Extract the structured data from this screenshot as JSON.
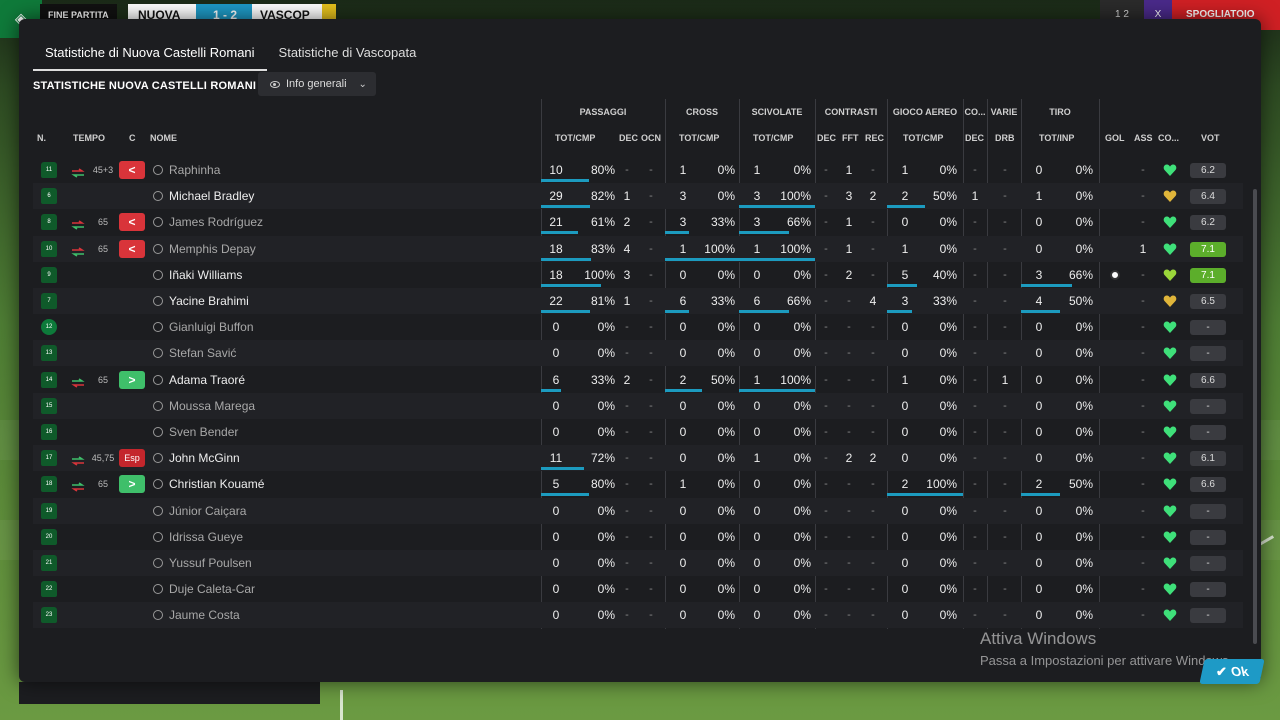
{
  "scoreboard": {
    "status": "FINE PARTITA",
    "home": "NUOVA",
    "score": "1 - 2",
    "away": "VASCOP",
    "right_a": "1 2",
    "right_b": "X",
    "right_c": "SPOGLIATOIO"
  },
  "tabs": [
    {
      "label": "Statistiche di Nuova Castelli Romani",
      "active": true
    },
    {
      "label": "Statistiche di Vascopata",
      "active": false
    }
  ],
  "section_title": "STATISTICHE NUOVA CASTELLI ROMANI",
  "view_dropdown": {
    "label": "Info generali"
  },
  "group_headers": {
    "passaggi": "PASSAGGI",
    "cross": "CROSS",
    "scivolate": "SCIVOLATE",
    "contrasti": "CONTRASTI",
    "gioco_aereo": "GIOCO AEREO",
    "co": "CO...",
    "varie": "VARIE",
    "tiro": "TIRO"
  },
  "column_headers": {
    "n": "N.",
    "tempo": "TEMPO",
    "c": "C",
    "nome": "NOME",
    "pass_tot": "TOT/CMP",
    "pass_dec": "DEC",
    "pass_ocn": "OCN",
    "cross_tot": "TOT/CMP",
    "sciv_tot": "TOT/CMP",
    "con_dec": "DEC",
    "con_fft": "FFT",
    "con_rec": "REC",
    "aereo_tot": "TOT/CMP",
    "co_dec": "DEC",
    "drb": "DRB",
    "tiro_tot": "TOT/INP",
    "gol": "GOL",
    "ass": "ASS",
    "co": "CO...",
    "vot": "VOT"
  },
  "rows": [
    {
      "n": "11",
      "tempo": "45+3",
      "sub": "out",
      "c": "<",
      "name": "Raphinha",
      "dim": true,
      "pass_t": "10",
      "pass_p": "80%",
      "pass_f": 0.8,
      "dec": "-",
      "ocn": "-",
      "cross_t": "1",
      "cross_p": "0%",
      "cross_f": 0,
      "sciv_t": "1",
      "sciv_p": "0%",
      "sciv_f": 0,
      "cdec": "-",
      "fft": "1",
      "rec": "-",
      "aer_t": "1",
      "aer_p": "0%",
      "aer_f": 0,
      "codec": "-",
      "drb": "-",
      "tiro_t": "0",
      "tiro_p": "0%",
      "tiro_f": 0,
      "gol": "",
      "ass": "-",
      "heart": "green",
      "vot": "6.2",
      "vot_good": false
    },
    {
      "n": "6",
      "tempo": "",
      "sub": "",
      "c": "",
      "name": "Michael Bradley",
      "dim": false,
      "pass_t": "29",
      "pass_p": "82%",
      "pass_f": 0.82,
      "dec": "1",
      "ocn": "-",
      "cross_t": "3",
      "cross_p": "0%",
      "cross_f": 0,
      "sciv_t": "3",
      "sciv_p": "100%",
      "sciv_f": 1,
      "cdec": "-",
      "fft": "3",
      "rec": "2",
      "aer_t": "2",
      "aer_p": "50%",
      "aer_f": 0.5,
      "codec": "1",
      "drb": "-",
      "tiro_t": "1",
      "tiro_p": "0%",
      "tiro_f": 0,
      "gol": "",
      "ass": "-",
      "heart": "gold",
      "vot": "6.4",
      "vot_good": false
    },
    {
      "n": "8",
      "tempo": "65",
      "sub": "out",
      "c": "<",
      "name": "James Rodríguez",
      "dim": true,
      "pass_t": "21",
      "pass_p": "61%",
      "pass_f": 0.61,
      "dec": "2",
      "ocn": "-",
      "cross_t": "3",
      "cross_p": "33%",
      "cross_f": 0.33,
      "sciv_t": "3",
      "sciv_p": "66%",
      "sciv_f": 0.66,
      "cdec": "-",
      "fft": "1",
      "rec": "-",
      "aer_t": "0",
      "aer_p": "0%",
      "aer_f": 0,
      "codec": "-",
      "drb": "-",
      "tiro_t": "0",
      "tiro_p": "0%",
      "tiro_f": 0,
      "gol": "",
      "ass": "-",
      "heart": "green",
      "vot": "6.2",
      "vot_good": false
    },
    {
      "n": "10",
      "tempo": "65",
      "sub": "out",
      "c": "<",
      "name": "Memphis Depay",
      "dim": true,
      "pass_t": "18",
      "pass_p": "83%",
      "pass_f": 0.83,
      "dec": "4",
      "ocn": "-",
      "cross_t": "1",
      "cross_p": "100%",
      "cross_f": 1,
      "sciv_t": "1",
      "sciv_p": "100%",
      "sciv_f": 1,
      "cdec": "-",
      "fft": "1",
      "rec": "-",
      "aer_t": "1",
      "aer_p": "0%",
      "aer_f": 0,
      "codec": "-",
      "drb": "-",
      "tiro_t": "0",
      "tiro_p": "0%",
      "tiro_f": 0,
      "gol": "",
      "ass": "1",
      "heart": "green",
      "vot": "7.1",
      "vot_good": true
    },
    {
      "n": "9",
      "tempo": "",
      "sub": "",
      "c": "",
      "name": "Iñaki Williams",
      "dim": false,
      "pass_t": "18",
      "pass_p": "100%",
      "pass_f": 1,
      "dec": "3",
      "ocn": "-",
      "cross_t": "0",
      "cross_p": "0%",
      "cross_f": 0,
      "sciv_t": "0",
      "sciv_p": "0%",
      "sciv_f": 0,
      "cdec": "-",
      "fft": "2",
      "rec": "-",
      "aer_t": "5",
      "aer_p": "40%",
      "aer_f": 0.4,
      "codec": "-",
      "drb": "-",
      "tiro_t": "3",
      "tiro_p": "66%",
      "tiro_f": 0.66,
      "gol": "ball",
      "ass": "-",
      "heart": "yellowgreen",
      "vot": "7.1",
      "vot_good": true
    },
    {
      "n": "7",
      "tempo": "",
      "sub": "",
      "c": "",
      "name": "Yacine Brahimi",
      "dim": false,
      "pass_t": "22",
      "pass_p": "81%",
      "pass_f": 0.81,
      "dec": "1",
      "ocn": "-",
      "cross_t": "6",
      "cross_p": "33%",
      "cross_f": 0.33,
      "sciv_t": "6",
      "sciv_p": "66%",
      "sciv_f": 0.66,
      "cdec": "-",
      "fft": "-",
      "rec": "4",
      "aer_t": "3",
      "aer_p": "33%",
      "aer_f": 0.33,
      "codec": "-",
      "drb": "-",
      "tiro_t": "4",
      "tiro_p": "50%",
      "tiro_f": 0.5,
      "gol": "",
      "ass": "-",
      "heart": "gold",
      "vot": "6.5",
      "vot_good": false
    },
    {
      "n": "12",
      "tempo": "",
      "sub": "",
      "c": "",
      "name": "Gianluigi Buffon",
      "dim": true,
      "gk": true,
      "pass_t": "0",
      "pass_p": "0%",
      "pass_f": 0,
      "dec": "-",
      "ocn": "-",
      "cross_t": "0",
      "cross_p": "0%",
      "cross_f": 0,
      "sciv_t": "0",
      "sciv_p": "0%",
      "sciv_f": 0,
      "cdec": "-",
      "fft": "-",
      "rec": "-",
      "aer_t": "0",
      "aer_p": "0%",
      "aer_f": 0,
      "codec": "-",
      "drb": "-",
      "tiro_t": "0",
      "tiro_p": "0%",
      "tiro_f": 0,
      "gol": "",
      "ass": "-",
      "heart": "green",
      "vot": "-",
      "vot_good": false
    },
    {
      "n": "13",
      "tempo": "",
      "sub": "",
      "c": "",
      "name": "Stefan Savić",
      "dim": true,
      "pass_t": "0",
      "pass_p": "0%",
      "pass_f": 0,
      "dec": "-",
      "ocn": "-",
      "cross_t": "0",
      "cross_p": "0%",
      "cross_f": 0,
      "sciv_t": "0",
      "sciv_p": "0%",
      "sciv_f": 0,
      "cdec": "-",
      "fft": "-",
      "rec": "-",
      "aer_t": "0",
      "aer_p": "0%",
      "aer_f": 0,
      "codec": "-",
      "drb": "-",
      "tiro_t": "0",
      "tiro_p": "0%",
      "tiro_f": 0,
      "gol": "",
      "ass": "-",
      "heart": "green",
      "vot": "-",
      "vot_good": false
    },
    {
      "n": "14",
      "tempo": "65",
      "sub": "in",
      "c": ">",
      "name": "Adama Traoré",
      "dim": false,
      "pass_t": "6",
      "pass_p": "33%",
      "pass_f": 0.33,
      "dec": "2",
      "ocn": "-",
      "cross_t": "2",
      "cross_p": "50%",
      "cross_f": 0.5,
      "sciv_t": "1",
      "sciv_p": "100%",
      "sciv_f": 1,
      "cdec": "-",
      "fft": "-",
      "rec": "-",
      "aer_t": "1",
      "aer_p": "0%",
      "aer_f": 0,
      "codec": "-",
      "drb": "1",
      "tiro_t": "0",
      "tiro_p": "0%",
      "tiro_f": 0,
      "gol": "",
      "ass": "-",
      "heart": "green",
      "vot": "6.6",
      "vot_good": false
    },
    {
      "n": "15",
      "tempo": "",
      "sub": "",
      "c": "",
      "name": "Moussa Marega",
      "dim": true,
      "pass_t": "0",
      "pass_p": "0%",
      "pass_f": 0,
      "dec": "-",
      "ocn": "-",
      "cross_t": "0",
      "cross_p": "0%",
      "cross_f": 0,
      "sciv_t": "0",
      "sciv_p": "0%",
      "sciv_f": 0,
      "cdec": "-",
      "fft": "-",
      "rec": "-",
      "aer_t": "0",
      "aer_p": "0%",
      "aer_f": 0,
      "codec": "-",
      "drb": "-",
      "tiro_t": "0",
      "tiro_p": "0%",
      "tiro_f": 0,
      "gol": "",
      "ass": "-",
      "heart": "green",
      "vot": "-",
      "vot_good": false
    },
    {
      "n": "16",
      "tempo": "",
      "sub": "",
      "c": "",
      "name": "Sven Bender",
      "dim": true,
      "pass_t": "0",
      "pass_p": "0%",
      "pass_f": 0,
      "dec": "-",
      "ocn": "-",
      "cross_t": "0",
      "cross_p": "0%",
      "cross_f": 0,
      "sciv_t": "0",
      "sciv_p": "0%",
      "sciv_f": 0,
      "cdec": "-",
      "fft": "-",
      "rec": "-",
      "aer_t": "0",
      "aer_p": "0%",
      "aer_f": 0,
      "codec": "-",
      "drb": "-",
      "tiro_t": "0",
      "tiro_p": "0%",
      "tiro_f": 0,
      "gol": "",
      "ass": "-",
      "heart": "green",
      "vot": "-",
      "vot_good": false
    },
    {
      "n": "17",
      "tempo": "45,75",
      "sub": "inred",
      "c": "Esp",
      "name": "John McGinn",
      "dim": false,
      "pass_t": "11",
      "pass_p": "72%",
      "pass_f": 0.72,
      "dec": "-",
      "ocn": "-",
      "cross_t": "0",
      "cross_p": "0%",
      "cross_f": 0,
      "sciv_t": "1",
      "sciv_p": "0%",
      "sciv_f": 0,
      "cdec": "-",
      "fft": "2",
      "rec": "2",
      "aer_t": "0",
      "aer_p": "0%",
      "aer_f": 0,
      "codec": "-",
      "drb": "-",
      "tiro_t": "0",
      "tiro_p": "0%",
      "tiro_f": 0,
      "gol": "",
      "ass": "-",
      "heart": "green",
      "vot": "6.1",
      "vot_good": false
    },
    {
      "n": "18",
      "tempo": "65",
      "sub": "in",
      "c": ">",
      "name": "Christian Kouamé",
      "dim": false,
      "pass_t": "5",
      "pass_p": "80%",
      "pass_f": 0.8,
      "dec": "-",
      "ocn": "-",
      "cross_t": "1",
      "cross_p": "0%",
      "cross_f": 0,
      "sciv_t": "0",
      "sciv_p": "0%",
      "sciv_f": 0,
      "cdec": "-",
      "fft": "-",
      "rec": "-",
      "aer_t": "2",
      "aer_p": "100%",
      "aer_f": 1,
      "codec": "-",
      "drb": "-",
      "tiro_t": "2",
      "tiro_p": "50%",
      "tiro_f": 0.5,
      "gol": "",
      "ass": "-",
      "heart": "green",
      "vot": "6.6",
      "vot_good": false
    },
    {
      "n": "19",
      "tempo": "",
      "sub": "",
      "c": "",
      "name": "Júnior Caiçara",
      "dim": true,
      "pass_t": "0",
      "pass_p": "0%",
      "pass_f": 0,
      "dec": "-",
      "ocn": "-",
      "cross_t": "0",
      "cross_p": "0%",
      "cross_f": 0,
      "sciv_t": "0",
      "sciv_p": "0%",
      "sciv_f": 0,
      "cdec": "-",
      "fft": "-",
      "rec": "-",
      "aer_t": "0",
      "aer_p": "0%",
      "aer_f": 0,
      "codec": "-",
      "drb": "-",
      "tiro_t": "0",
      "tiro_p": "0%",
      "tiro_f": 0,
      "gol": "",
      "ass": "-",
      "heart": "green",
      "vot": "-",
      "vot_good": false
    },
    {
      "n": "20",
      "tempo": "",
      "sub": "",
      "c": "",
      "name": "Idrissa Gueye",
      "dim": true,
      "pass_t": "0",
      "pass_p": "0%",
      "pass_f": 0,
      "dec": "-",
      "ocn": "-",
      "cross_t": "0",
      "cross_p": "0%",
      "cross_f": 0,
      "sciv_t": "0",
      "sciv_p": "0%",
      "sciv_f": 0,
      "cdec": "-",
      "fft": "-",
      "rec": "-",
      "aer_t": "0",
      "aer_p": "0%",
      "aer_f": 0,
      "codec": "-",
      "drb": "-",
      "tiro_t": "0",
      "tiro_p": "0%",
      "tiro_f": 0,
      "gol": "",
      "ass": "-",
      "heart": "green",
      "vot": "-",
      "vot_good": false
    },
    {
      "n": "21",
      "tempo": "",
      "sub": "",
      "c": "",
      "name": "Yussuf Poulsen",
      "dim": true,
      "pass_t": "0",
      "pass_p": "0%",
      "pass_f": 0,
      "dec": "-",
      "ocn": "-",
      "cross_t": "0",
      "cross_p": "0%",
      "cross_f": 0,
      "sciv_t": "0",
      "sciv_p": "0%",
      "sciv_f": 0,
      "cdec": "-",
      "fft": "-",
      "rec": "-",
      "aer_t": "0",
      "aer_p": "0%",
      "aer_f": 0,
      "codec": "-",
      "drb": "-",
      "tiro_t": "0",
      "tiro_p": "0%",
      "tiro_f": 0,
      "gol": "",
      "ass": "-",
      "heart": "green",
      "vot": "-",
      "vot_good": false
    },
    {
      "n": "22",
      "tempo": "",
      "sub": "",
      "c": "",
      "name": "Duje Caleta-Car",
      "dim": true,
      "pass_t": "0",
      "pass_p": "0%",
      "pass_f": 0,
      "dec": "-",
      "ocn": "-",
      "cross_t": "0",
      "cross_p": "0%",
      "cross_f": 0,
      "sciv_t": "0",
      "sciv_p": "0%",
      "sciv_f": 0,
      "cdec": "-",
      "fft": "-",
      "rec": "-",
      "aer_t": "0",
      "aer_p": "0%",
      "aer_f": 0,
      "codec": "-",
      "drb": "-",
      "tiro_t": "0",
      "tiro_p": "0%",
      "tiro_f": 0,
      "gol": "",
      "ass": "-",
      "heart": "green",
      "vot": "-",
      "vot_good": false
    },
    {
      "n": "23",
      "tempo": "",
      "sub": "",
      "c": "",
      "name": "Jaume Costa",
      "dim": true,
      "pass_t": "0",
      "pass_p": "0%",
      "pass_f": 0,
      "dec": "-",
      "ocn": "-",
      "cross_t": "0",
      "cross_p": "0%",
      "cross_f": 0,
      "sciv_t": "0",
      "sciv_p": "0%",
      "sciv_f": 0,
      "cdec": "-",
      "fft": "-",
      "rec": "-",
      "aer_t": "0",
      "aer_p": "0%",
      "aer_f": 0,
      "codec": "-",
      "drb": "-",
      "tiro_t": "0",
      "tiro_p": "0%",
      "tiro_f": 0,
      "gol": "",
      "ass": "-",
      "heart": "green",
      "vot": "-",
      "vot_good": false
    }
  ],
  "watermark": {
    "line1": "Attiva Windows",
    "line2": "Passa a Impostazioni per attivare Windows."
  },
  "ok_button": {
    "label": "Ok"
  },
  "colors": {
    "accent": "#1e9ac6",
    "good_rating": "#5cae2b",
    "sub_out": "#d9343a",
    "sub_in": "#3fbf6a",
    "heart_green": "#3fe07a",
    "heart_gold": "#e0b53a"
  }
}
